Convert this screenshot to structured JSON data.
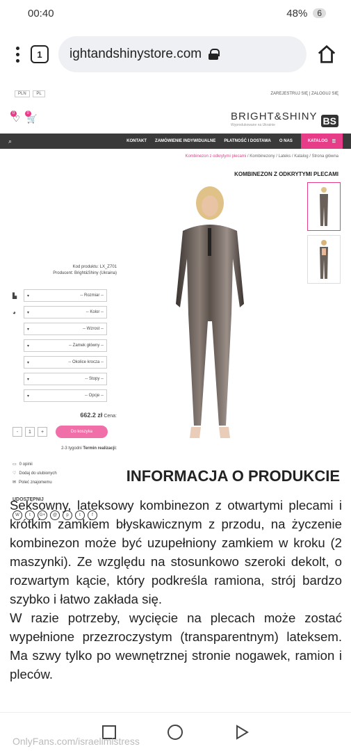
{
  "status": {
    "time": "00:40",
    "battery": "48%",
    "notifications": "6"
  },
  "browser": {
    "url": "ightandshinystore.com",
    "tabs_count": "1"
  },
  "site": {
    "topbar": {
      "login": "ZALOGUJ SIĘ",
      "register": "ZAREJESTRUJ SIĘ",
      "lang": "PL",
      "currency": "PLN"
    },
    "logo": {
      "mark": "BS",
      "name": "BRIGHT&SHINY",
      "tagline": "Wyprodukowane na Ukrainie"
    },
    "cart_count": "0",
    "wish_count": "0",
    "nav": {
      "katalog": "KATALOG",
      "items": [
        "O NAS",
        "PŁATNOŚĆ I DOSTAWA",
        "ZAMÓWIENIE INDYWIDUALNE",
        "KONTAKT"
      ]
    },
    "breadcrumb": [
      "Strona główna",
      "Katalog",
      "Lateks",
      "Kombinezony"
    ],
    "breadcrumb_last": "Kombinezon z odkrytymi plecami",
    "product_title": "KOMBINEZON Z ODKRYTYMI PLECAMI"
  },
  "product": {
    "code": "Kod produktu: LX_Z701",
    "producer": "Producent: Bright&Shiny (Ukraina)",
    "selects": [
      "-- Rozmiar --",
      "-- Kolor --",
      "-- Wzrost --",
      "-- Zamek główny --",
      "-- Okolice krocza --",
      "-- Stopy --",
      "-- Opcje --"
    ],
    "price_label": "Cena:",
    "price": "662.2 zł",
    "qty_minus": "-",
    "qty": "1",
    "qty_plus": "+",
    "add_to_cart": "Do koszyka",
    "realization_label": "Termin realizacji:",
    "realization": "2-3 tygodni",
    "opinions": "0 opinii",
    "add_favorites": "Dodaj do ulubionych",
    "tell_friend": "Poleć znajomemu",
    "share": "UDOSTĘPNIJ",
    "share_icons": [
      "f",
      "t",
      "p",
      "@",
      "G+",
      "t",
      "W"
    ]
  },
  "info": {
    "heading": "INFORMACJA O PRODUKCIE",
    "p1": "Seksowny, lateksowy kombinezon z otwartymi plecami i krótkim zamkiem błyskawicznym z przodu, na życzenie kombinezon może być uzupełniony zamkiem w kroku (2 maszynki). Ze względu na stosunkowo szeroki dekolt, o rozwartym kącie, który podkreśla ramiona, strój bardzo szybko i łatwo zakłada się.",
    "p2": "W razie potrzeby, wycięcie na plecach może zostać wypełnione przezroczystym (transparentnym) lateksem. Ma szwy tylko po wewnętrznej stronie nogawek, ramion i pleców."
  },
  "watermark": "OnlyFans.com/israelimistress",
  "colors": {
    "accent": "#e73c88",
    "nav_bg": "#3a3a3a"
  }
}
